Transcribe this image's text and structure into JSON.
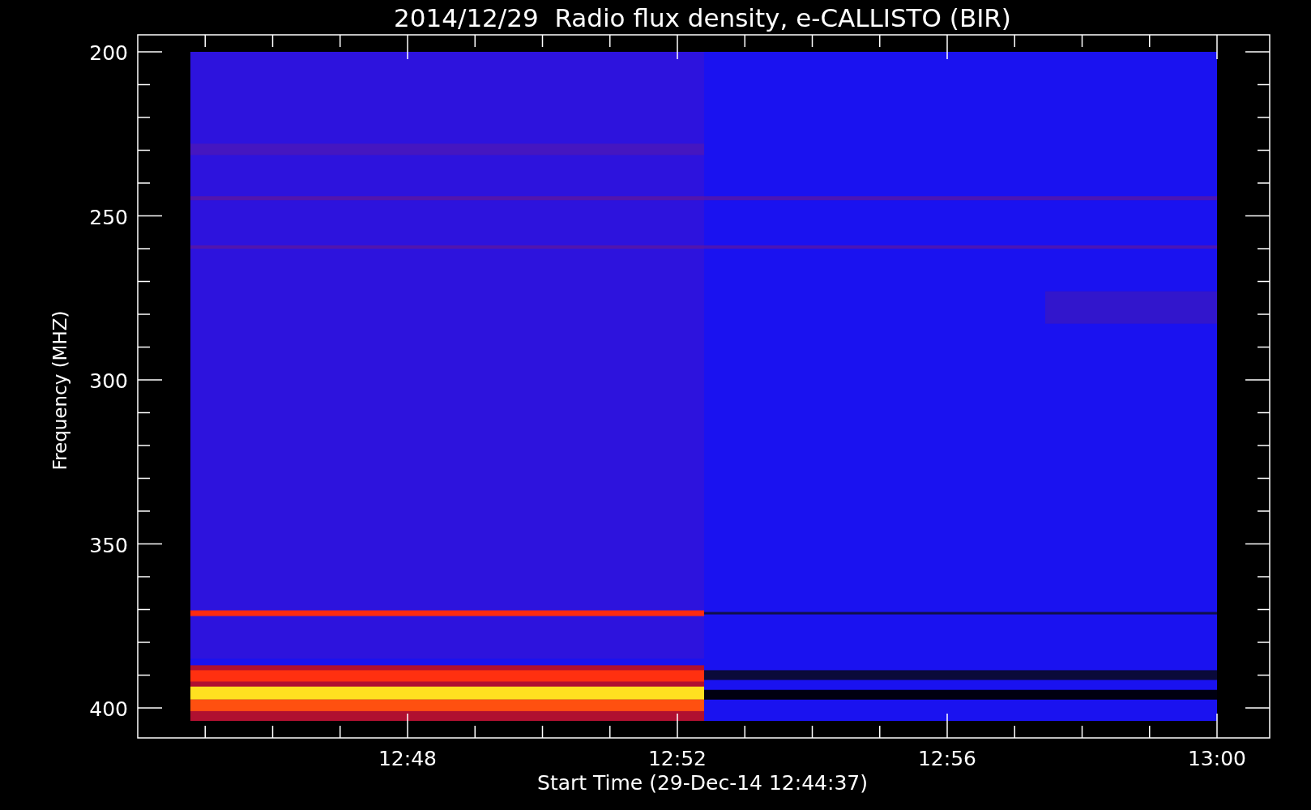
{
  "title": "2014/12/29  Radio flux density, e-CALLISTO (BIR)",
  "y_axis": {
    "label": "Frequency (MHZ)",
    "ticks": [
      "200",
      "250",
      "300",
      "350",
      "400"
    ]
  },
  "x_axis": {
    "label": "Start Time (29-Dec-14 12:44:37)",
    "ticks": [
      "12:48",
      "12:52",
      "12:56",
      "13:00"
    ]
  }
}
